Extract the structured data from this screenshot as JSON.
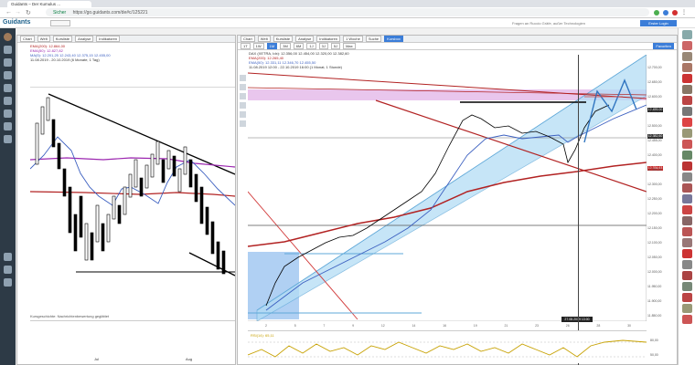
{
  "browser": {
    "tab_title": "Guidants – Der Kumulus ...",
    "secure_label": "Sicher",
    "url": "https://go.guidants.com/de#c/125221",
    "user_button": "Erster Login"
  },
  "app": {
    "logo": "Guidants",
    "left_toolbar": {
      "tools": [
        "Chart",
        "Welt",
        "Kursliste",
        "Analyse",
        "Indikatoren"
      ],
      "legend": [
        "EMA(200): 12.864,00",
        "EMA(50): 12.827,82",
        "MA(5): 12.201,25  12.243,40  12.375,15  12.455,00",
        "11.08.2019 - 20.10.2019 (6 Monate, 1 Tag)"
      ],
      "footer": "Kursgeschichte: Nachrichtenbewertung geglättet"
    },
    "right_toolbar": {
      "tools": [
        "Chart",
        "Welt",
        "Kursliste",
        "Analyse",
        "Indikatoren",
        "1 Woche",
        "Suche",
        "Kursbox"
      ],
      "timeframes": [
        "1T",
        "1W",
        "1M",
        "3M",
        "6M",
        "1J",
        "3J",
        "5J",
        "Max"
      ],
      "legend": [
        "DAX (XETRA, Idx): 12.356,00  12.454,00  12.320,00  12.382,60",
        "EMA(200): 12.265,40",
        "EMA(50): 12.331,11  12.346,70  12.455,50",
        "11.08.2019 12:00 - 22.10.2019 16:00 (1 Monat, 1 Stunde)"
      ],
      "sub_label": "RSI(14): 65,11",
      "date_marker": "27.08.2019 13:00",
      "button_right": "Favoriten"
    },
    "price_axis": [
      "12.700,00",
      "12.650,00",
      "12.600,00",
      "12.550,00",
      "12.500,00",
      "12.455,00",
      "12.400,00",
      "12.350,00",
      "12.300,00",
      "12.250,00",
      "12.200,00",
      "12.150,00",
      "12.100,00",
      "12.050,00",
      "12.000,00",
      "11.950,00",
      "11.900,00",
      "11.850,00"
    ],
    "price_tags": {
      "last": "12.455,00",
      "red": "12.334,63",
      "dark": "12.382,60"
    },
    "x_axis": [
      "2",
      "5",
      "7",
      "9",
      "12",
      "14",
      "16",
      "19",
      "21",
      "23",
      "26",
      "28",
      "30"
    ],
    "left_x_axis": [
      "Jul",
      "Aug"
    ],
    "rsi_axis": [
      "80,00",
      "50,00"
    ],
    "chat_hint": "Fragen an Ruccio Gräfe, außer Technologien",
    "colors": {
      "accent": "#3b7dd8",
      "sidebar": "#2d3a46",
      "channel": "#b3ddf5",
      "resistance": "#e4b8e8",
      "ema": "#b22222",
      "candle_up": "#ffffff",
      "candle_down": "#000000"
    }
  }
}
